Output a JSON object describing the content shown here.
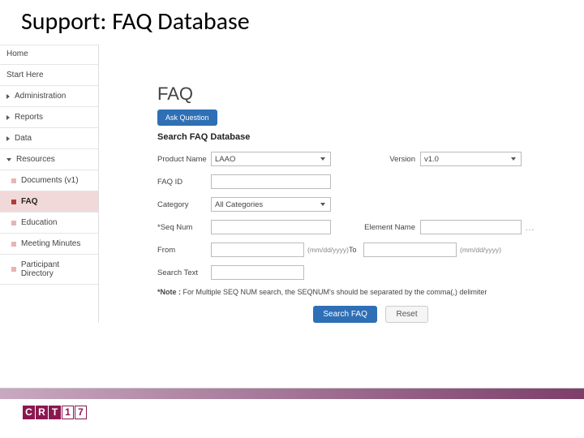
{
  "page_title": "Support: FAQ Database",
  "sidebar": {
    "home": "Home",
    "start_here": "Start Here",
    "administration": "Administration",
    "reports": "Reports",
    "data": "Data",
    "resources": "Resources",
    "sub": {
      "documents": "Documents (v1)",
      "faq": "FAQ",
      "education": "Education",
      "meeting_minutes": "Meeting Minutes",
      "participant_directory": "Participant Directory"
    }
  },
  "main": {
    "heading": "FAQ",
    "ask_button": "Ask Question",
    "search_heading": "Search FAQ Database",
    "labels": {
      "product_name": "Product Name",
      "version": "Version",
      "faq_id": "FAQ ID",
      "category": "Category",
      "seq_num": "*Seq Num",
      "element_name": "Element Name",
      "from": "From",
      "to": "To",
      "search_text": "Search Text"
    },
    "values": {
      "product_name": "LAAO",
      "version": "v1.0",
      "category": "All Categories"
    },
    "date_hint": "(mm/dd/yyyy)",
    "ellipsis": "…",
    "note_label": "*Note : ",
    "note_text": "For Multiple SEQ NUM search, the SEQNUM's should be separated by the comma(,) delimiter",
    "search_btn": "Search FAQ",
    "reset_btn": "Reset"
  },
  "footer": {
    "logo": [
      "C",
      "R",
      "T",
      "1",
      "7"
    ]
  }
}
